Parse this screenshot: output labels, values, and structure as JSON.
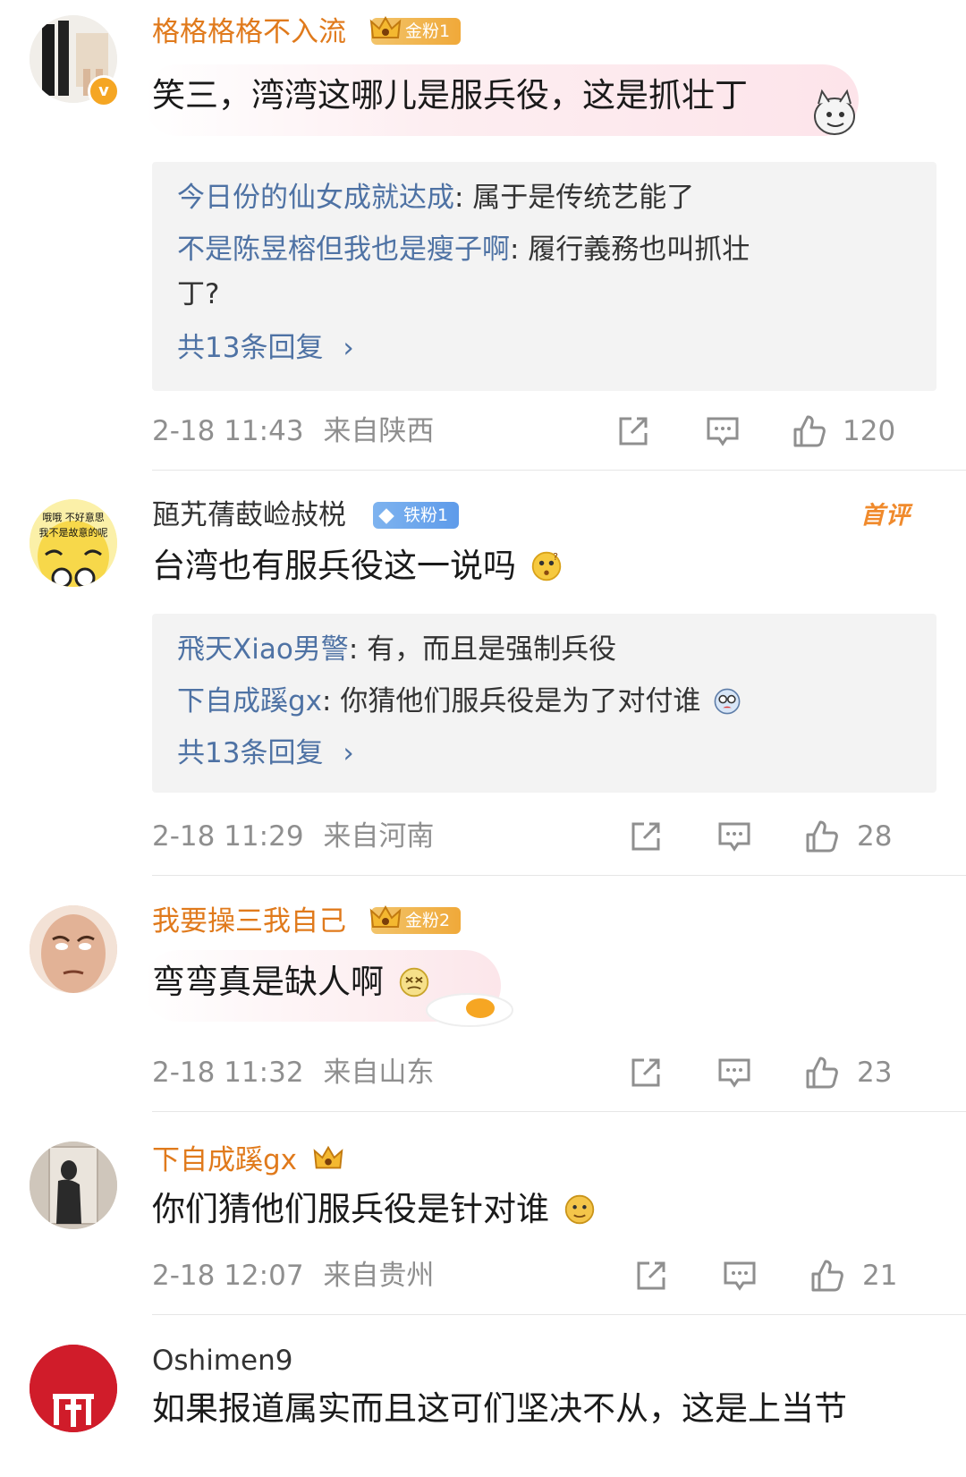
{
  "colors": {
    "gold": "#e07a1c",
    "link": "#4e72a4",
    "meta": "#8f8f8f",
    "reply_bg": "#f3f3f3"
  },
  "comments": [
    {
      "username": "格格格格不入流",
      "badge": "金粉1",
      "text": "笑三，湾湾这哪儿是服兵役，这是抓壮丁",
      "replies": [
        {
          "user": "今日份的仙女成就达成",
          "text": ": 属于是传统艺能了"
        },
        {
          "user": "不是陈昱榕但我也是瘦子啊",
          "text": ": 履行義務也叫抓壮",
          "text2": "丁?"
        }
      ],
      "reply_count": "共13条回复",
      "time": "2-18 11:43",
      "location": "来自陕西",
      "likes": "120"
    },
    {
      "username": "瓸艽蒨菣崄敊棁",
      "badge": "铁粉1",
      "tag": "首评",
      "avatar_text": [
        "哦哦 不好意思",
        "我不是故意的呢"
      ],
      "text": "台湾也有服兵役这一说吗",
      "replies": [
        {
          "user": "飛天Xiao男警",
          "text": ": 有，而且是强制兵役"
        },
        {
          "user": "下自成蹊gx",
          "text": ": 你猜他们服兵役是为了对付谁"
        }
      ],
      "reply_count": "共13条回复",
      "time": "2-18 11:29",
      "location": "来自河南",
      "likes": "28"
    },
    {
      "username": "我要操三我自己",
      "badge": "金粉2",
      "text": "弯弯真是缺人啊",
      "time": "2-18 11:32",
      "location": "来自山东",
      "likes": "23"
    },
    {
      "username": "下自成蹊gx",
      "text": "你们猜他们服兵役是针对谁",
      "time": "2-18 12:07",
      "location": "来自贵州",
      "likes": "21"
    },
    {
      "username": "Oshimen9",
      "text": "如果报道属实而且这可们坚决不从，这是上当节"
    }
  ]
}
